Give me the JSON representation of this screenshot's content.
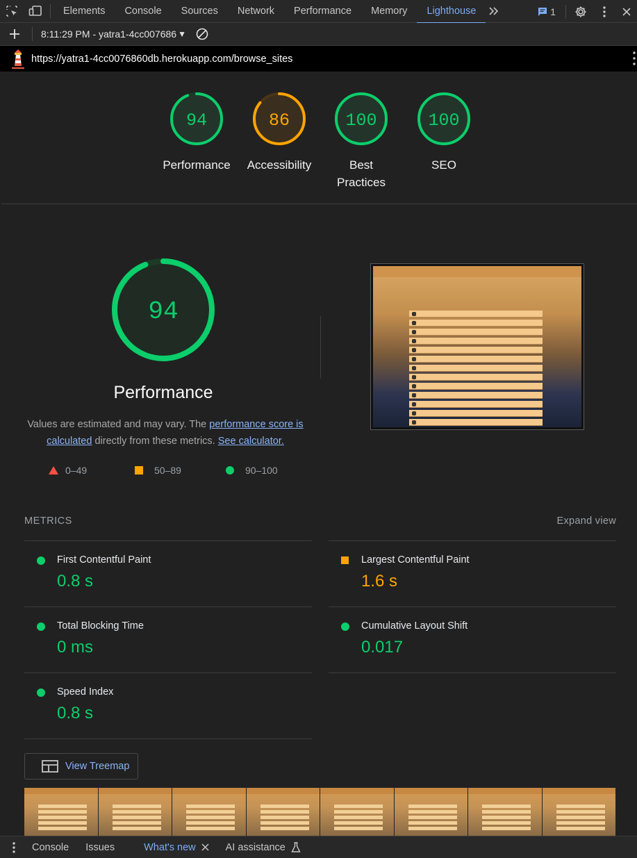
{
  "toolbar": {
    "tabs": [
      {
        "label": "Elements"
      },
      {
        "label": "Console"
      },
      {
        "label": "Sources"
      },
      {
        "label": "Network"
      },
      {
        "label": "Performance"
      },
      {
        "label": "Memory"
      },
      {
        "label": "Lighthouse"
      }
    ],
    "issues_count": "1"
  },
  "report_bar": {
    "report_selector": "8:11:29 PM - yatra1-4cc007686"
  },
  "url_bar": {
    "url": "https://yatra1-4cc0076860db.herokuapp.com/browse_sites"
  },
  "colors": {
    "pass": "#0cce6b",
    "average": "#ffa400",
    "fail": "#ff4e42",
    "link": "#8ab4f8"
  },
  "scores": [
    {
      "label": "Performance",
      "value": "94",
      "score": 0.94,
      "status": "pass"
    },
    {
      "label": "Accessibility",
      "value": "86",
      "score": 0.86,
      "status": "average"
    },
    {
      "label": "Best Practices",
      "value": "100",
      "score": 1.0,
      "status": "pass"
    },
    {
      "label": "SEO",
      "value": "100",
      "score": 1.0,
      "status": "pass"
    }
  ],
  "performance": {
    "score": "94",
    "title": "Performance",
    "desc_prefix": "Values are estimated and may vary. The ",
    "desc_link1": "performance score is calculated",
    "desc_middle": " directly from these metrics. ",
    "desc_link2": "See calculator."
  },
  "legend": [
    {
      "range": "0–49",
      "shape": "triangle"
    },
    {
      "range": "50–89",
      "shape": "square"
    },
    {
      "range": "90–100",
      "shape": "circle"
    }
  ],
  "metrics": {
    "heading": "METRICS",
    "expand_label": "Expand view",
    "items": [
      {
        "name": "First Contentful Paint",
        "value": "0.8 s",
        "status": "pass"
      },
      {
        "name": "Largest Contentful Paint",
        "value": "1.6 s",
        "status": "average"
      },
      {
        "name": "Total Blocking Time",
        "value": "0 ms",
        "status": "pass"
      },
      {
        "name": "Cumulative Layout Shift",
        "value": "0.017",
        "status": "pass"
      },
      {
        "name": "Speed Index",
        "value": "0.8 s",
        "status": "pass"
      }
    ]
  },
  "treemap": {
    "label": "View Treemap"
  },
  "drawer": {
    "tabs": [
      {
        "label": "Console"
      },
      {
        "label": "Issues"
      },
      {
        "label": "What's new"
      },
      {
        "label": "AI assistance"
      }
    ]
  }
}
